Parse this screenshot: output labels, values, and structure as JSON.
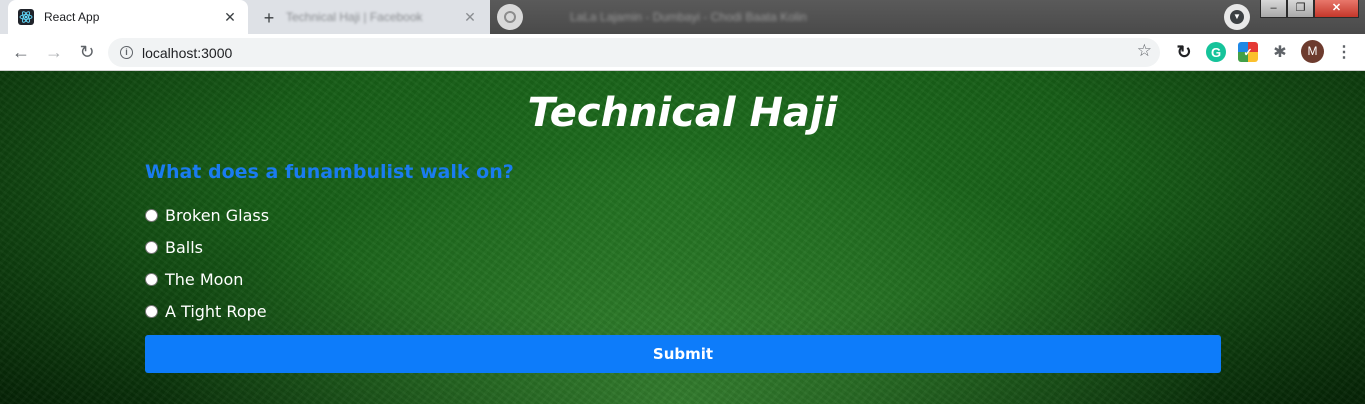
{
  "browser": {
    "tabs": [
      {
        "title": "React App",
        "close": "✕"
      },
      {
        "title": "Technical Haji | Facebook",
        "close": "✕"
      }
    ],
    "new_tab": "+",
    "blurred_title": "LaLa Lajamin - Dumbayi - Chodi Baata Kolin",
    "window_controls": {
      "minimize": "–",
      "restore": "❐",
      "close": "✕"
    },
    "nav": {
      "back": "←",
      "forward": "→",
      "reload": "↻"
    },
    "address": {
      "info": "i",
      "url": "localhost:3000",
      "star": "☆"
    },
    "extensions": {
      "sync": "↻",
      "grammarly": "G",
      "colorful": "✓",
      "puzzle": "✱"
    },
    "profile_initial": "M",
    "menu": "⋮"
  },
  "app": {
    "title": "Technical Haji",
    "question": "What does a funambulist walk on?",
    "options": [
      {
        "label": "Broken Glass"
      },
      {
        "label": "Balls"
      },
      {
        "label": "The Moon"
      },
      {
        "label": "A Tight Rope"
      }
    ],
    "submit_label": "Submit"
  },
  "colors": {
    "accent": "#0d7cfa",
    "question": "#1a7cf0",
    "background": "#1f6e1f"
  }
}
